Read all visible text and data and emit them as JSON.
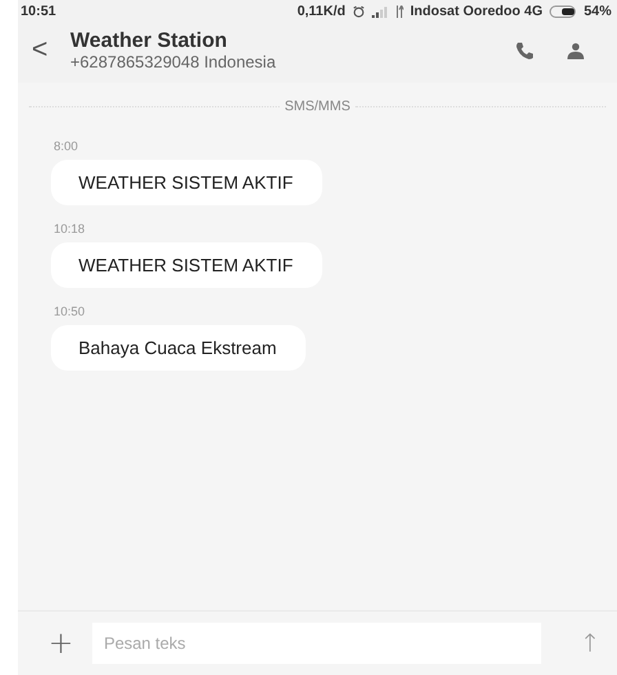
{
  "status_bar": {
    "time": "10:51",
    "speed": "0,11K/d",
    "carrier": "Indosat Ooredoo 4G",
    "battery": "54%"
  },
  "header": {
    "back": "<",
    "title": "Weather Station",
    "subtitle": "+6287865329048 Indonesia"
  },
  "divider_label": "SMS/MMS",
  "messages": [
    {
      "time": "8:00",
      "text": "WEATHER SISTEM AKTIF"
    },
    {
      "time": "10:18",
      "text": "WEATHER SISTEM AKTIF"
    },
    {
      "time": "10:50",
      "text": "Bahaya Cuaca Ekstream"
    }
  ],
  "composer": {
    "attach": "+",
    "placeholder": "Pesan teks",
    "send": "↑"
  }
}
